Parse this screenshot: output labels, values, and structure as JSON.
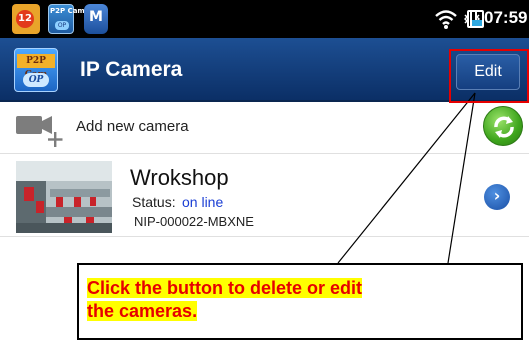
{
  "status_bar": {
    "notification_count": "12",
    "app2_line1": "P2P Cam",
    "app2_line2": "OP",
    "app3_letter": "M",
    "time": "07:59",
    "icons": [
      "app-notification-icon",
      "p2pcam-icon",
      "m-app-icon",
      "wifi-icon",
      "vibrate-icon",
      "battery-icon"
    ]
  },
  "header": {
    "logo_line1": "P2P Cam",
    "logo_line2": "OP",
    "title": "IP Camera",
    "edit_label": "Edit"
  },
  "add_camera": {
    "label": "Add new camera",
    "icons": [
      "add-camera-icon",
      "refresh-icon"
    ]
  },
  "cameras": [
    {
      "name": "Wrokshop",
      "status_label": "Status:",
      "status_value": "on line",
      "id": "NIP-000022-MBXNE",
      "status_color": "#1a3ed4"
    }
  ],
  "annotation": {
    "text": "Click the button to delete or edit the cameras.",
    "line1": "Click the button to delete or edit",
    "line2": "the cameras.",
    "text_color": "#e60000",
    "highlight_color": "#ffff00",
    "box_color": "#e60000"
  },
  "colors": {
    "titlebar": "#1d4f93",
    "status_bar": "#000000",
    "accent_green": "#3ea51c"
  }
}
